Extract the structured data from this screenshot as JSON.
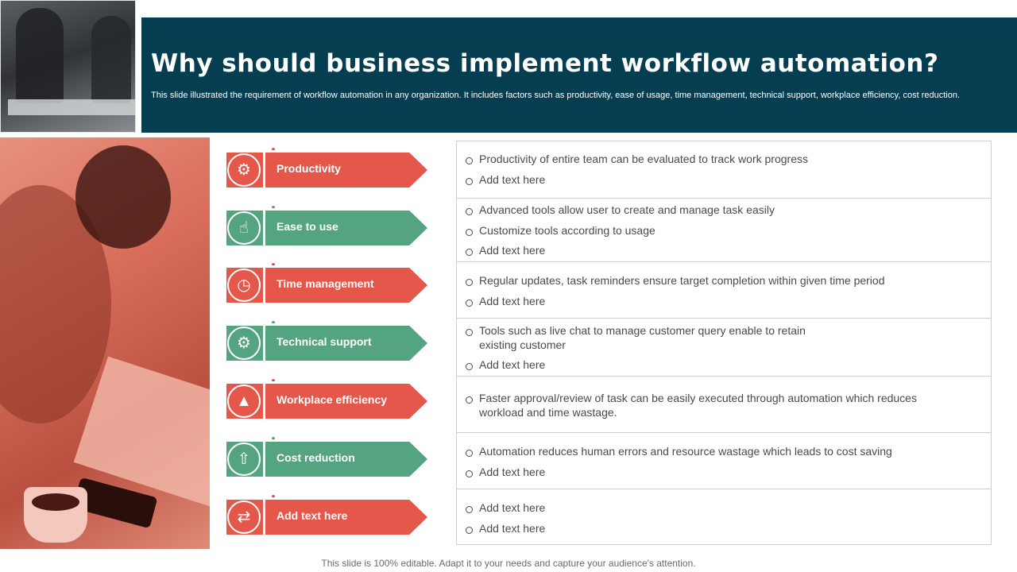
{
  "header": {
    "title": "Why should business implement workflow automation?",
    "subtitle": "This slide illustrated the requirement of workflow automation in any organization. It includes factors such as productivity, ease of usage, time management, technical support, workplace efficiency, cost reduction."
  },
  "factors": [
    {
      "label": "Productivity",
      "icon": "productivity-gauge-icon",
      "color": "#e5574a"
    },
    {
      "label": "Ease to use",
      "icon": "hand-pointer-icon",
      "color": "#54a381"
    },
    {
      "label": "Time management",
      "icon": "clock-chart-icon",
      "color": "#e5574a"
    },
    {
      "label": "Technical support",
      "icon": "gear-hand-icon",
      "color": "#54a381"
    },
    {
      "label": "Workplace efficiency",
      "icon": "growth-chart-icon",
      "color": "#e5574a"
    },
    {
      "label": "Cost reduction",
      "icon": "coin-arrow-icon",
      "color": "#54a381"
    },
    {
      "label": "Add text here",
      "icon": "process-arrows-icon",
      "color": "#e5574a"
    }
  ],
  "descriptions": [
    [
      "Productivity of entire team can be evaluated to track work progress",
      "Add text here"
    ],
    [
      "Advanced tools allow user to create and manage task easily",
      "Customize tools according to usage",
      "Add text here"
    ],
    [
      "Regular updates, task reminders ensure target completion within given time period",
      "Add text here"
    ],
    [
      "Tools such as live chat to manage customer query enable to retain existing customer",
      "Add text here"
    ],
    [
      "Faster approval/review of task can be easily executed through automation which reduces workload and time wastage."
    ],
    [
      "Automation reduces human errors and resource wastage which leads to cost saving",
      "Add text here"
    ],
    [
      "Add text here",
      "Add text here"
    ]
  ],
  "footer": "This slide is 100% editable. Adapt it to your needs and capture your audience's attention.",
  "colors": {
    "header_bg": "#053d51",
    "red": "#e5574a",
    "green": "#54a381"
  }
}
